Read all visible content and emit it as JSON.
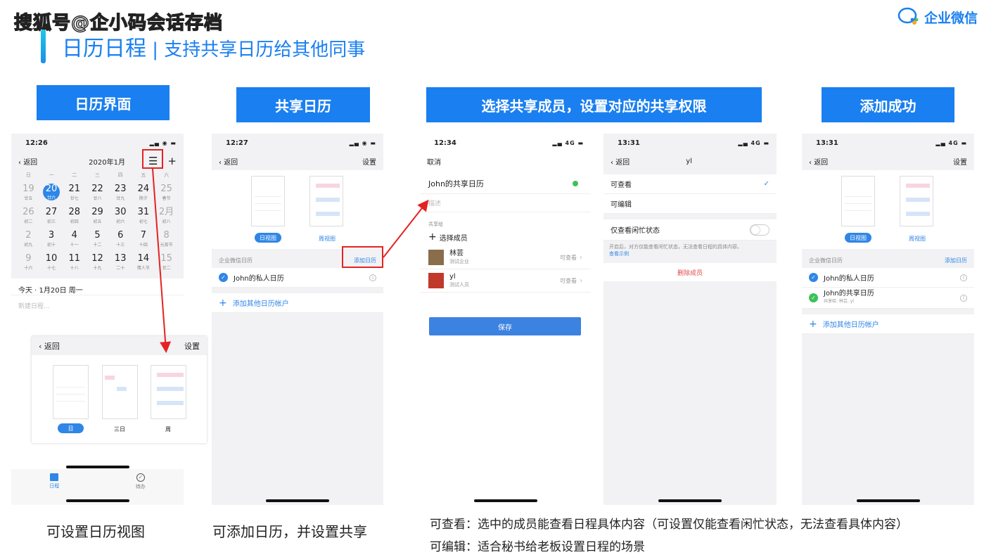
{
  "watermark": "搜狐号@企小码会话存档",
  "title": {
    "main": "日历日程",
    "sep": " | ",
    "sub": "支持共享日历给其他同事"
  },
  "brand": {
    "name": "企业微信",
    "accent": "#1a7ff0"
  },
  "headers": [
    "日历界面",
    "共享日历",
    "选择共享成员，设置对应的共享权限",
    "添加成功"
  ],
  "captions": {
    "p1": "可设置日历视图",
    "p2": "可添加日历，并设置共享",
    "note1": "可查看：选中的成员能查看日程具体内容（可设置仅能查看闲忙状态，无法查看具体内容）",
    "note2": "可编辑：适合秘书给老板设置日程的场景"
  },
  "p1": {
    "time": "12:26",
    "back": "返回",
    "month": "2020年1月",
    "weekdays": [
      "日",
      "一",
      "二",
      "三",
      "四",
      "五",
      "六"
    ],
    "days": [
      [
        "19",
        "廿五",
        1
      ],
      [
        "20",
        "廿六",
        2
      ],
      [
        "21",
        "廿七",
        0
      ],
      [
        "22",
        "廿八",
        0
      ],
      [
        "23",
        "廿九",
        0
      ],
      [
        "24",
        "除夕",
        0
      ],
      [
        "25",
        "春节",
        1
      ],
      [
        "26",
        "初二",
        1
      ],
      [
        "27",
        "初三",
        0
      ],
      [
        "28",
        "初四",
        0
      ],
      [
        "29",
        "初五",
        0
      ],
      [
        "30",
        "初六",
        0
      ],
      [
        "31",
        "初七",
        0
      ],
      [
        "2月",
        "初八",
        1
      ],
      [
        "2",
        "初九",
        1
      ],
      [
        "3",
        "初十",
        0
      ],
      [
        "4",
        "十一",
        0
      ],
      [
        "5",
        "十二",
        0
      ],
      [
        "6",
        "十三",
        0
      ],
      [
        "7",
        "十四",
        0
      ],
      [
        "8",
        "元宵节",
        1
      ],
      [
        "9",
        "十六",
        1
      ],
      [
        "10",
        "十七",
        0
      ],
      [
        "11",
        "十八",
        0
      ],
      [
        "12",
        "十九",
        0
      ],
      [
        "13",
        "二十",
        0
      ],
      [
        "14",
        "情人节",
        0
      ],
      [
        "15",
        "廿二",
        1
      ]
    ],
    "today": "今天 · 1月20日 周一",
    "new_event": "新建日程...",
    "sheet": {
      "back": "返回",
      "settings": "设置",
      "views": [
        "日",
        "三日",
        "周"
      ]
    },
    "tabs": [
      "日程",
      "待办"
    ]
  },
  "p2": {
    "time": "12:27",
    "back": "返回",
    "settings": "设置",
    "views": [
      "日视图",
      "周视图"
    ],
    "section": "企业微信日历",
    "add_cal": "添加日历",
    "cal": "John的私人日历",
    "add_account": "添加其他日历帐户"
  },
  "p3": {
    "time": "12:34",
    "cancel": "取消",
    "cal_name": "John的共享日历",
    "desc": "描述",
    "share_to": "共享给",
    "choose": "选择成员",
    "members": [
      {
        "name": "林芸",
        "org": "测试企业",
        "perm": "可查看"
      },
      {
        "name": "yl",
        "org": "测试人员",
        "perm": "可查看"
      }
    ],
    "save": "保存"
  },
  "p4": {
    "time": "13:31",
    "back": "返回",
    "name": "yl",
    "opt1": "可查看",
    "opt2": "可编辑",
    "busy": "仅查看闲忙状态",
    "hint": "开启后，对方仅能查看闲忙状态，无法查看日程的具体内容。",
    "example": "查看示例",
    "remove": "删除成员"
  },
  "p5": {
    "time": "13:31",
    "back": "返回",
    "settings": "设置",
    "views": [
      "日视图",
      "周视图"
    ],
    "section": "企业微信日历",
    "add_cal": "添加日历",
    "cal1": "John的私人日历",
    "cal2": "John的共享日历",
    "cal2_sub": "共享给: 林芸, yl",
    "add_account": "添加其他日历帐户"
  },
  "status_net": "4G"
}
